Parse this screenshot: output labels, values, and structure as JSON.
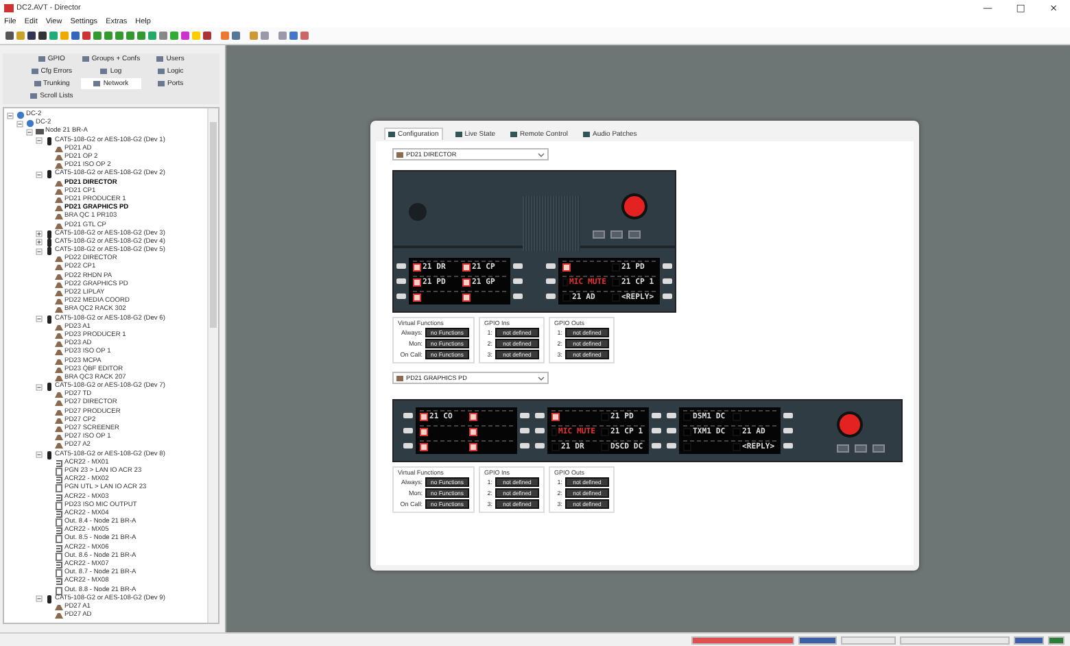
{
  "window": {
    "title": "DC2.AVT - Director",
    "controls": [
      "—",
      "□",
      "×"
    ]
  },
  "menu": [
    "File",
    "Edit",
    "View",
    "Settings",
    "Extras",
    "Help"
  ],
  "sidebar": {
    "tabs": [
      {
        "label": "GPIO",
        "selected": false
      },
      {
        "label": "Groups + Confs",
        "selected": false
      },
      {
        "label": "Users",
        "selected": false
      },
      {
        "label": "Cfg Errors",
        "selected": false
      },
      {
        "label": "Log",
        "selected": false
      },
      {
        "label": "Logic",
        "selected": false
      },
      {
        "label": "Trunking",
        "selected": false
      },
      {
        "label": "Network",
        "selected": true
      },
      {
        "label": "Ports",
        "selected": false
      },
      {
        "label": "Scroll Lists",
        "selected": false
      }
    ]
  },
  "tree": [
    {
      "label": "DC-2",
      "kind": "network",
      "expanded": true,
      "children": [
        {
          "label": "DC-2",
          "kind": "network",
          "expanded": true,
          "children": [
            {
              "label": "Node 21 BR-A",
              "kind": "node",
              "expanded": true,
              "children": [
                {
                  "label": "CAT5-108-G2 or AES-108-G2 (Dev 1)",
                  "kind": "card",
                  "expanded": true,
                  "children": [
                    {
                      "label": "PD21 AD",
                      "kind": "panel"
                    },
                    {
                      "label": "PD21 OP 2",
                      "kind": "panel"
                    },
                    {
                      "label": "PD21 ISO OP 2",
                      "kind": "panel"
                    }
                  ]
                },
                {
                  "label": "CAT5-108-G2 or AES-108-G2 (Dev 2)",
                  "kind": "card",
                  "expanded": true,
                  "children": [
                    {
                      "label": "PD21 DIRECTOR",
                      "kind": "panel",
                      "active": true
                    },
                    {
                      "label": "PD21 CP1",
                      "kind": "panel",
                      "active": false
                    },
                    {
                      "label": "PD21 PRODUCER 1",
                      "kind": "panel",
                      "active": false
                    },
                    {
                      "label": "PD21 GRAPHICS PD",
                      "kind": "panel",
                      "active": true
                    },
                    {
                      "label": "BRA QC 1 PR103",
                      "kind": "panel",
                      "active": false
                    },
                    {
                      "label": "PD21 GTL CP",
                      "kind": "panel",
                      "active": false
                    }
                  ]
                },
                {
                  "label": "CAT5-108-G2 or AES-108-G2 (Dev 3)",
                  "kind": "card",
                  "expanded": false
                },
                {
                  "label": "CAT5-108-G2 or AES-108-G2 (Dev 4)",
                  "kind": "card",
                  "expanded": false
                },
                {
                  "label": "CAT5-108-G2 or AES-108-G2 (Dev 5)",
                  "kind": "card",
                  "expanded": true,
                  "children": [
                    {
                      "label": "PD22 DIRECTOR",
                      "kind": "panel"
                    },
                    {
                      "label": "PD22 CP1",
                      "kind": "panel"
                    },
                    {
                      "label": "PD22 RHDN PA",
                      "kind": "panel"
                    },
                    {
                      "label": "PD22 GRAPHICS PD",
                      "kind": "panel"
                    },
                    {
                      "label": "PD22 LIPLAY",
                      "kind": "panel"
                    },
                    {
                      "label": "PD22 MEDIA COORD",
                      "kind": "panel"
                    },
                    {
                      "label": "BRA QC2 RACK 302",
                      "kind": "panel"
                    }
                  ]
                },
                {
                  "label": "CAT5-108-G2 or AES-108-G2 (Dev 6)",
                  "kind": "card",
                  "expanded": true,
                  "children": [
                    {
                      "label": "PD23 A1",
                      "kind": "panel"
                    },
                    {
                      "label": "PD23 PRODUCER 1",
                      "kind": "panel"
                    },
                    {
                      "label": "PD23 AD",
                      "kind": "panel"
                    },
                    {
                      "label": "PD23 ISO OP 1",
                      "kind": "panel"
                    },
                    {
                      "label": "PD23 MCPA",
                      "kind": "panel"
                    },
                    {
                      "label": "PD23 QBF EDITOR",
                      "kind": "panel"
                    },
                    {
                      "label": "BRA QC3 RACK 207",
                      "kind": "panel"
                    }
                  ]
                },
                {
                  "label": "CAT5-108-G2 or AES-108-G2 (Dev 7)",
                  "kind": "card",
                  "expanded": true,
                  "children": [
                    {
                      "label": "PD27 TD",
                      "kind": "panel"
                    },
                    {
                      "label": "PD27 DIRECTOR",
                      "kind": "panel"
                    },
                    {
                      "label": "PD27 PRODUCER",
                      "kind": "panel"
                    },
                    {
                      "label": "PD27 CP2",
                      "kind": "panel"
                    },
                    {
                      "label": "PD27 SCREENER",
                      "kind": "panel"
                    },
                    {
                      "label": "PD27 ISO OP 1",
                      "kind": "panel"
                    },
                    {
                      "label": "PD27 A2",
                      "kind": "panel"
                    }
                  ]
                },
                {
                  "label": "CAT5-108-G2 or AES-108-G2 (Dev 8)",
                  "kind": "card",
                  "expanded": true,
                  "children": [
                    {
                      "label": "ACR22 - MX01",
                      "kind": "input"
                    },
                    {
                      "label": "PGN 23 > LAN IO ACR 23",
                      "kind": "output"
                    },
                    {
                      "label": "ACR22 - MX02",
                      "kind": "input"
                    },
                    {
                      "label": "PGN UTL > LAN IO ACR 23",
                      "kind": "output"
                    },
                    {
                      "label": "ACR22 - MX03",
                      "kind": "input"
                    },
                    {
                      "label": "PD23 ISO MIC OUTPUT",
                      "kind": "output"
                    },
                    {
                      "label": "ACR22 - MX04",
                      "kind": "input"
                    },
                    {
                      "label": "Out. 8.4 - Node 21 BR-A",
                      "kind": "output"
                    },
                    {
                      "label": "ACR22 - MX05",
                      "kind": "input"
                    },
                    {
                      "label": "Out. 8.5 - Node 21 BR-A",
                      "kind": "output"
                    },
                    {
                      "label": "ACR22 - MX06",
                      "kind": "input"
                    },
                    {
                      "label": "Out. 8.6 - Node 21 BR-A",
                      "kind": "output"
                    },
                    {
                      "label": "ACR22 - MX07",
                      "kind": "input"
                    },
                    {
                      "label": "Out. 8.7 - Node 21 BR-A",
                      "kind": "output"
                    },
                    {
                      "label": "ACR22 - MX08",
                      "kind": "input"
                    },
                    {
                      "label": "Out. 8.8 - Node 21 BR-A",
                      "kind": "output"
                    }
                  ]
                },
                {
                  "label": "CAT5-108-G2 or AES-108-G2 (Dev 9)",
                  "kind": "card",
                  "expanded": true,
                  "children": [
                    {
                      "label": "PD27 A1",
                      "kind": "panel"
                    },
                    {
                      "label": "PD27 AD",
                      "kind": "panel"
                    }
                  ]
                }
              ]
            }
          ]
        }
      ]
    }
  ],
  "dialog": {
    "tabs": [
      {
        "label": "Configuration",
        "selected": true
      },
      {
        "label": "Live State",
        "selected": false
      },
      {
        "label": "Remote Control",
        "selected": false
      },
      {
        "label": "Audio Patches",
        "selected": false
      }
    ],
    "panels": [
      {
        "device": "PD21 DIRECTOR",
        "kind": "desktop",
        "displays": [
          {
            "rows": [
              [
                {
                  "text": "21 DR",
                  "lit": true,
                  "color": "#dddddd"
                },
                {
                  "text": "21 CP",
                  "lit": true,
                  "color": "#dddddd"
                }
              ],
              [
                {
                  "text": "21 PD",
                  "lit": true,
                  "color": "#dddddd"
                },
                {
                  "text": "21 GP",
                  "lit": true,
                  "color": "#dddddd"
                }
              ],
              [
                {
                  "lit": true
                },
                {
                  "lit": true
                }
              ]
            ]
          },
          {
            "rows": [
              [
                {
                  "lit": true
                },
                {
                  "text": "21 PD",
                  "lit": false,
                  "color": "#dddddd"
                }
              ],
              [
                {
                  "text": "MIC MUTE",
                  "lit": false,
                  "color": "#e33333"
                },
                {
                  "text": "21 CP 1",
                  "lit": false,
                  "color": "#dddddd"
                }
              ],
              [
                {
                  "text": "21 AD",
                  "lit": false,
                  "color": "#dddddd"
                },
                {
                  "text": "<REPLY>",
                  "lit": false,
                  "color": "#dddddd"
                }
              ]
            ]
          }
        ],
        "functions": [
          {
            "title": "Virtual Functions",
            "rows": [
              {
                "label": "Always:",
                "value": "no Functions"
              },
              {
                "label": "Mon:",
                "value": "no Functions"
              },
              {
                "label": "On Call:",
                "value": "no Functions"
              }
            ]
          },
          {
            "title": "GPIO Ins",
            "rows": [
              {
                "label": "1:",
                "value": "not defined"
              },
              {
                "label": "2:",
                "value": "not defined"
              },
              {
                "label": "3:",
                "value": "not defined"
              }
            ]
          },
          {
            "title": "GPIO Outs",
            "rows": [
              {
                "label": "1:",
                "value": "not defined"
              },
              {
                "label": "2:",
                "value": "not defined"
              },
              {
                "label": "3:",
                "value": "not defined"
              }
            ]
          }
        ]
      },
      {
        "device": "PD21 GRAPHICS PD",
        "kind": "panel",
        "displays": [
          {
            "rows": [
              [
                {
                  "text": "21 CO",
                  "lit": true,
                  "color": "#dddddd"
                },
                {
                  "lit": true
                }
              ],
              [
                {
                  "lit": true
                },
                {
                  "lit": true
                }
              ],
              [
                {
                  "lit": true
                },
                {
                  "lit": true
                }
              ]
            ]
          },
          {
            "rows": [
              [
                {
                  "lit": true
                },
                {
                  "text": "21 PD",
                  "lit": false,
                  "color": "#dddddd"
                }
              ],
              [
                {
                  "text": "MIC MUTE",
                  "lit": false,
                  "color": "#e33333"
                },
                {
                  "text": "21 CP 1",
                  "lit": false,
                  "color": "#dddddd"
                }
              ],
              [
                {
                  "text": "21 DR",
                  "lit": false,
                  "color": "#dddddd"
                },
                {
                  "text": "DSCD DC",
                  "lit": false,
                  "color": "#dddddd"
                }
              ]
            ]
          },
          {
            "rows": [
              [
                {
                  "text": "DSM1 DC",
                  "lit": false,
                  "color": "#dddddd"
                },
                {
                  "lit": false
                }
              ],
              [
                {
                  "text": "TXM1 DC",
                  "lit": false,
                  "color": "#dddddd"
                },
                {
                  "text": "21 AD",
                  "lit": false,
                  "color": "#dddddd"
                }
              ],
              [
                {
                  "lit": false
                },
                {
                  "text": "<REPLY>",
                  "lit": false,
                  "color": "#dddddd"
                }
              ]
            ]
          }
        ],
        "functions": [
          {
            "title": "Virtual Functions",
            "rows": [
              {
                "label": "Always:",
                "value": "no Functions"
              },
              {
                "label": "Mon:",
                "value": "no Functions"
              },
              {
                "label": "On Call:",
                "value": "no Functions"
              }
            ]
          },
          {
            "title": "GPIO Ins",
            "rows": [
              {
                "label": "1:",
                "value": "not defined"
              },
              {
                "label": "2:",
                "value": "not defined"
              },
              {
                "label": "3:",
                "value": "not defined"
              }
            ]
          },
          {
            "title": "GPIO Outs",
            "rows": [
              {
                "label": "1:",
                "value": "not defined"
              },
              {
                "label": "2:",
                "value": "not defined"
              },
              {
                "label": "3:",
                "value": "not defined"
              }
            ]
          }
        ]
      }
    ]
  }
}
